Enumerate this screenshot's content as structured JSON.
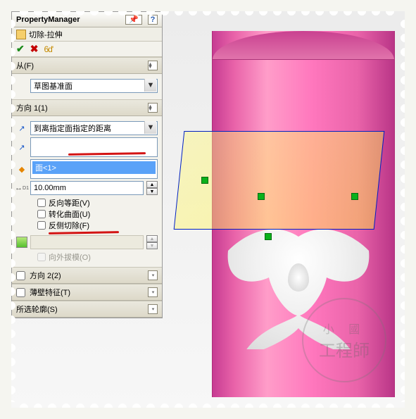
{
  "pm": {
    "title": "PropertyManager"
  },
  "feature": {
    "name": "切除-拉伸"
  },
  "from": {
    "header": "从(F)",
    "plane": "草图基准面"
  },
  "dir1": {
    "header": "方向 1(1)",
    "endcond": "到离指定面指定的距离",
    "face": "面<1>",
    "offset": "10.00mm",
    "reverse_offset": "反向等距(V)",
    "translate_surface": "转化曲面(U)",
    "flip_side": "反侧切除(F)",
    "draft_out": "向外拔模(O)"
  },
  "dir2": {
    "header": "方向 2(2)"
  },
  "thin": {
    "header": "薄壁特征(T)"
  },
  "contours": {
    "header": "所选轮廓(S)"
  },
  "watermark": {
    "line1": "小 國",
    "line2": "工程師"
  }
}
